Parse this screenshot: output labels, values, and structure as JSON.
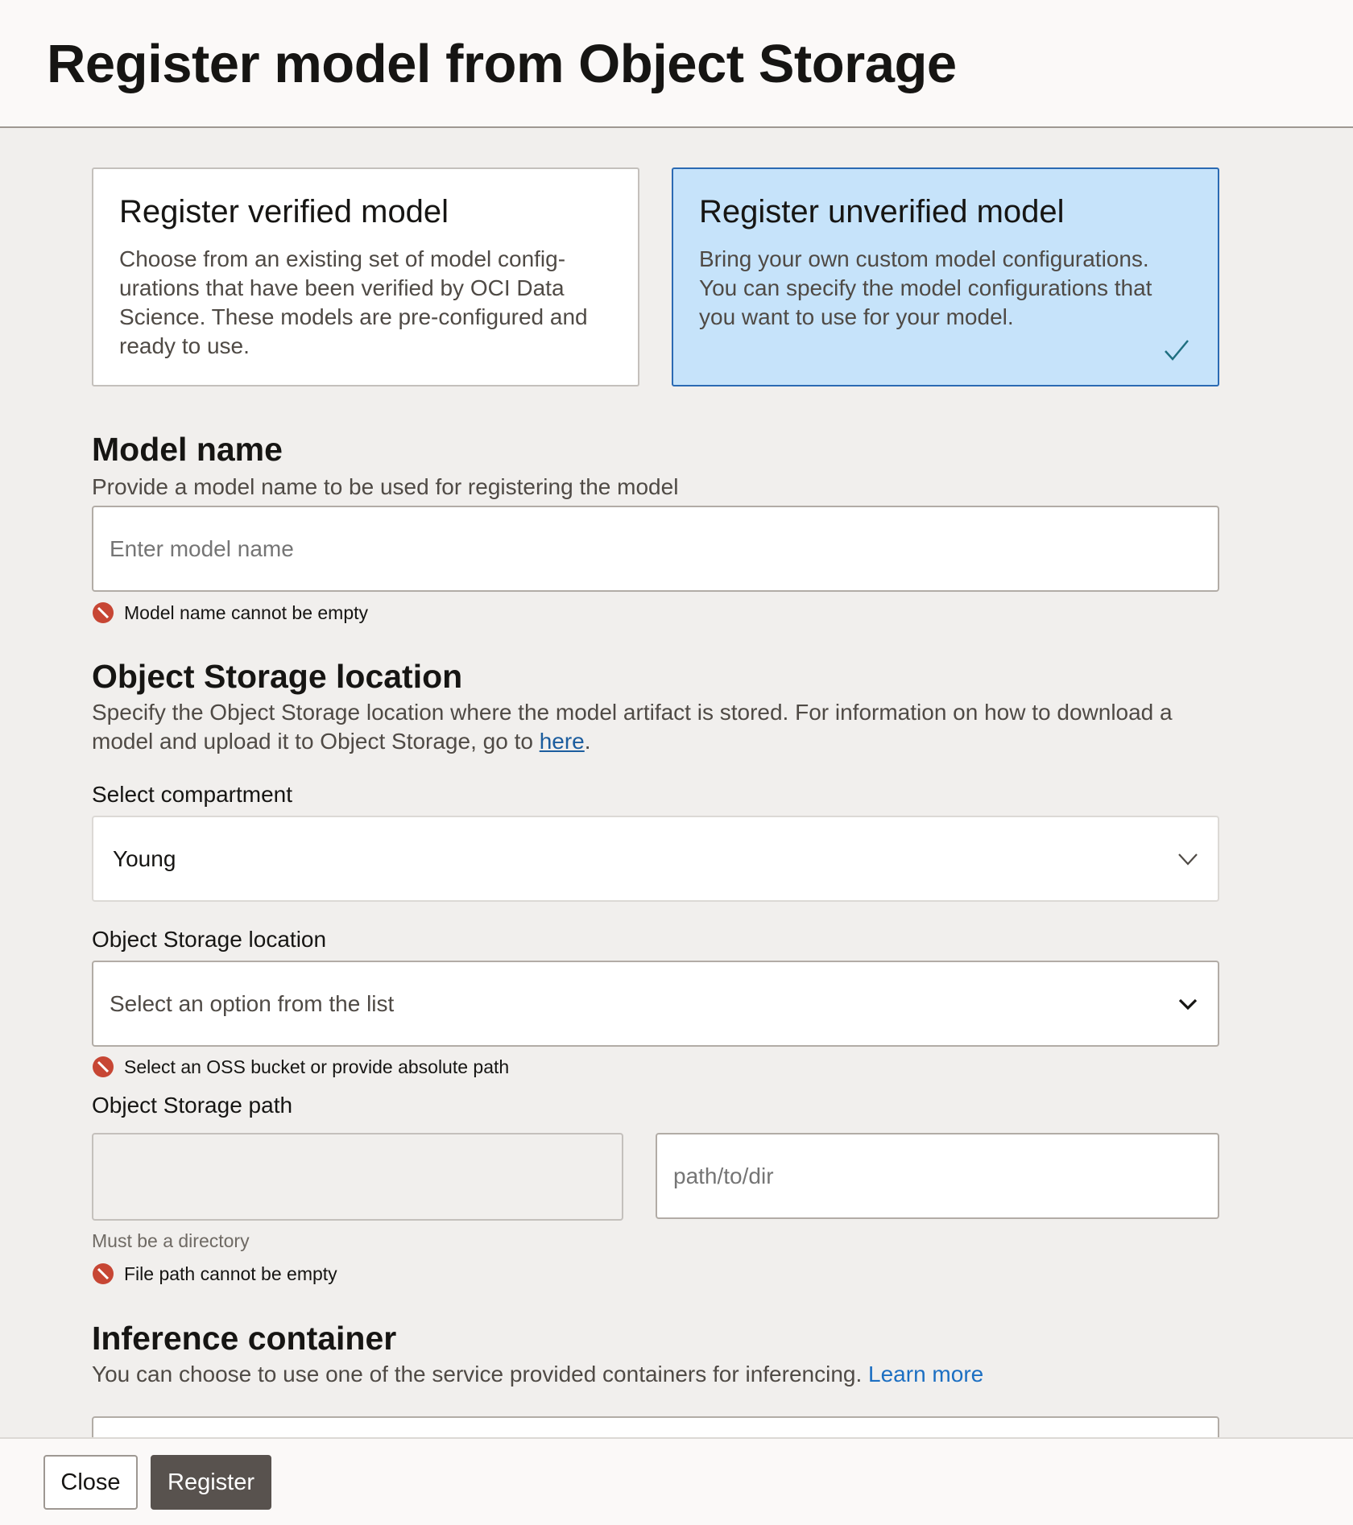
{
  "header": {
    "title": "Register model from Object Storage"
  },
  "cards": [
    {
      "title": "Register verified model",
      "description": "Choose from an existing set of model config-urations that have been verified by OCI Data Science. These models are pre-configured and ready to use.",
      "selected": false
    },
    {
      "title": "Register unverified model",
      "description": "Bring your own custom model configurations. You can specify the model configurations that you want to use for your model.",
      "selected": true
    }
  ],
  "model_name": {
    "title": "Model name",
    "description": "Provide a model name to be used for registering the model",
    "placeholder": "Enter model name",
    "error": "Model name cannot be empty"
  },
  "object_storage": {
    "title": "Object Storage location",
    "description_prefix": "Specify the Object Storage location where the model artifact is stored. For information on how to download a model and upload it to Object Storage, go to ",
    "link_text": "here",
    "description_suffix": ".",
    "compartment_label": "Select compartment",
    "compartment_value": "Young",
    "location_label": "Object Storage location",
    "location_placeholder": "Select an option from the list",
    "location_error": "Select an OSS bucket or provide absolute path",
    "path_label": "Object Storage path",
    "path_prefix_value": "",
    "path_placeholder": "path/to/dir",
    "path_helper": "Must be a directory",
    "path_error": "File path cannot be empty"
  },
  "inference": {
    "title": "Inference container",
    "description": "You can choose to use one of the service provided containers for inferencing. ",
    "link_text": "Learn more"
  },
  "footer": {
    "close_label": "Close",
    "register_label": "Register"
  },
  "colors": {
    "selected_card_bg": "#c6e3fa",
    "selected_card_border": "#2b6ab3",
    "error": "#c74634",
    "primary_button": "#58524e",
    "link": "#1c6fc2"
  },
  "icons": {
    "check": "check-icon",
    "error": "error-icon",
    "chevron": "chevron-down-icon"
  }
}
